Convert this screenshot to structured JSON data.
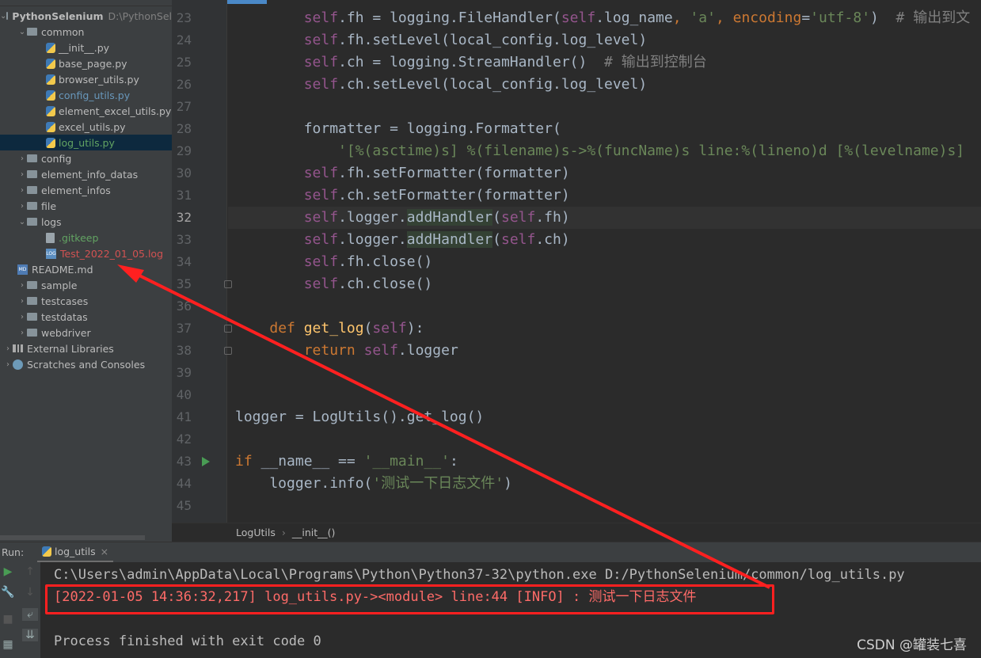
{
  "project": {
    "root_name": "PythonSelenium",
    "root_path": "D:\\PythonSel",
    "tree": [
      {
        "label": "common",
        "type": "folder",
        "expanded": true,
        "indent": 1
      },
      {
        "label": "__init__.py",
        "type": "py",
        "indent": 2
      },
      {
        "label": "base_page.py",
        "type": "py",
        "indent": 2
      },
      {
        "label": "browser_utils.py",
        "type": "py",
        "indent": 2
      },
      {
        "label": "config_utils.py",
        "type": "py",
        "indent": 2,
        "color": "blue"
      },
      {
        "label": "element_excel_utils.py",
        "type": "py",
        "indent": 2
      },
      {
        "label": "excel_utils.py",
        "type": "py",
        "indent": 2
      },
      {
        "label": "log_utils.py",
        "type": "py",
        "indent": 2,
        "color": "green",
        "selected": true
      },
      {
        "label": "config",
        "type": "folder",
        "indent": 1
      },
      {
        "label": "element_info_datas",
        "type": "folder",
        "indent": 1
      },
      {
        "label": "element_infos",
        "type": "folder",
        "indent": 1
      },
      {
        "label": "file",
        "type": "folder",
        "indent": 1
      },
      {
        "label": "logs",
        "type": "folder",
        "expanded": true,
        "indent": 1
      },
      {
        "label": ".gitkeep",
        "type": "file",
        "indent": 2,
        "color": "green"
      },
      {
        "label": "Test_2022_01_05.log",
        "type": "log",
        "indent": 2,
        "color": "red"
      },
      {
        "label": "README.md",
        "type": "md",
        "indent": 1,
        "leaf": true
      },
      {
        "label": "sample",
        "type": "folder",
        "indent": 1
      },
      {
        "label": "testcases",
        "type": "folder",
        "indent": 1
      },
      {
        "label": "testdatas",
        "type": "folder",
        "indent": 1
      },
      {
        "label": "webdriver",
        "type": "folder",
        "indent": 1
      },
      {
        "label": "External Libraries",
        "type": "lib",
        "indent": 0
      },
      {
        "label": "Scratches and Consoles",
        "type": "scratch",
        "indent": 0
      }
    ]
  },
  "editor": {
    "current_line": 32,
    "run_marker_line": 43,
    "fold_lines": [
      35,
      37,
      38
    ],
    "lines": [
      {
        "n": 23,
        "seg": [
          [
            "        ",
            ""
          ],
          [
            "self",
            "t-self"
          ],
          [
            ".fh = logging.FileHandler(",
            ""
          ],
          [
            "self",
            "t-self"
          ],
          [
            ".log_name",
            ""
          ],
          [
            ", ",
            "t-kw"
          ],
          [
            "'a'",
            "t-str"
          ],
          [
            ", ",
            "t-kw"
          ],
          [
            "encoding",
            "t-kw"
          ],
          [
            "=",
            ""
          ],
          [
            "'utf-8'",
            "t-str"
          ],
          [
            ")  ",
            ""
          ],
          [
            "# 输出到文",
            "t-cm"
          ]
        ]
      },
      {
        "n": 24,
        "seg": [
          [
            "        ",
            ""
          ],
          [
            "self",
            "t-self"
          ],
          [
            ".fh.setLevel(local_config.log_level)",
            ""
          ]
        ]
      },
      {
        "n": 25,
        "seg": [
          [
            "        ",
            ""
          ],
          [
            "self",
            "t-self"
          ],
          [
            ".ch = logging.StreamHandler()  ",
            ""
          ],
          [
            "# 输出到控制台",
            "t-cm"
          ]
        ]
      },
      {
        "n": 26,
        "seg": [
          [
            "        ",
            ""
          ],
          [
            "self",
            "t-self"
          ],
          [
            ".ch.setLevel(local_config.log_level)",
            ""
          ]
        ]
      },
      {
        "n": 27,
        "seg": []
      },
      {
        "n": 28,
        "seg": [
          [
            "        formatter = logging.Formatter(",
            ""
          ]
        ]
      },
      {
        "n": 29,
        "seg": [
          [
            "            ",
            ""
          ],
          [
            "'[%(asctime)s] %(filename)s->%(funcName)s line:%(lineno)d [%(levelname)s]",
            "t-str"
          ]
        ]
      },
      {
        "n": 30,
        "seg": [
          [
            "        ",
            ""
          ],
          [
            "self",
            "t-self"
          ],
          [
            ".fh.setFormatter(formatter)",
            ""
          ]
        ]
      },
      {
        "n": 31,
        "seg": [
          [
            "        ",
            ""
          ],
          [
            "self",
            "t-self"
          ],
          [
            ".ch.setFormatter(formatter)",
            ""
          ]
        ]
      },
      {
        "n": 32,
        "seg": [
          [
            "        ",
            ""
          ],
          [
            "self",
            "t-self"
          ],
          [
            ".logger.",
            ""
          ],
          [
            "addHandler",
            "t-hl"
          ],
          [
            "(",
            ""
          ],
          [
            "self",
            "t-self"
          ],
          [
            ".fh)",
            ""
          ]
        ]
      },
      {
        "n": 33,
        "seg": [
          [
            "        ",
            ""
          ],
          [
            "self",
            "t-self"
          ],
          [
            ".logger.",
            ""
          ],
          [
            "addHandler",
            "t-hl"
          ],
          [
            "(",
            ""
          ],
          [
            "self",
            "t-self"
          ],
          [
            ".ch)",
            ""
          ]
        ]
      },
      {
        "n": 34,
        "seg": [
          [
            "        ",
            ""
          ],
          [
            "self",
            "t-self"
          ],
          [
            ".fh.close()",
            ""
          ]
        ]
      },
      {
        "n": 35,
        "seg": [
          [
            "        ",
            ""
          ],
          [
            "self",
            "t-self"
          ],
          [
            ".ch.close()",
            ""
          ]
        ]
      },
      {
        "n": 36,
        "seg": []
      },
      {
        "n": 37,
        "seg": [
          [
            "    ",
            ""
          ],
          [
            "def ",
            "t-kw"
          ],
          [
            "get_log",
            "t-fn"
          ],
          [
            "(",
            ""
          ],
          [
            "self",
            "t-self"
          ],
          [
            "):",
            ""
          ]
        ]
      },
      {
        "n": 38,
        "seg": [
          [
            "        ",
            ""
          ],
          [
            "return ",
            "t-kw"
          ],
          [
            "self",
            "t-self"
          ],
          [
            ".logger",
            ""
          ]
        ]
      },
      {
        "n": 39,
        "seg": []
      },
      {
        "n": 40,
        "seg": []
      },
      {
        "n": 41,
        "seg": [
          [
            "logger = LogUtils().get_log()",
            ""
          ]
        ]
      },
      {
        "n": 42,
        "seg": []
      },
      {
        "n": 43,
        "seg": [
          [
            "if ",
            "t-kw"
          ],
          [
            "__name__ == ",
            ""
          ],
          [
            "'__main__'",
            "t-str"
          ],
          [
            ":",
            ""
          ]
        ]
      },
      {
        "n": 44,
        "seg": [
          [
            "    logger.info(",
            ""
          ],
          [
            "'测试一下日志文件'",
            "t-str"
          ],
          [
            ")",
            ""
          ]
        ]
      },
      {
        "n": 45,
        "seg": []
      }
    ]
  },
  "breadcrumb": {
    "items": [
      "LogUtils",
      "__init__()"
    ]
  },
  "run": {
    "label": "Run:",
    "tab": "log_utils",
    "lines": [
      "C:\\Users\\admin\\AppData\\Local\\Programs\\Python\\Python37-32\\python.exe D:/PythonSelenium/common/log_utils.py",
      "[2022-01-05 14:36:32,217] log_utils.py-><module> line:44 [INFO] : 测试一下日志文件",
      "",
      "Process finished with exit code 0"
    ]
  },
  "watermark": "CSDN @罐装七喜",
  "colors": {
    "annotation": "#ff2020",
    "sidebar_bg": "#3c3f41",
    "editor_bg": "#2b2b2b"
  }
}
